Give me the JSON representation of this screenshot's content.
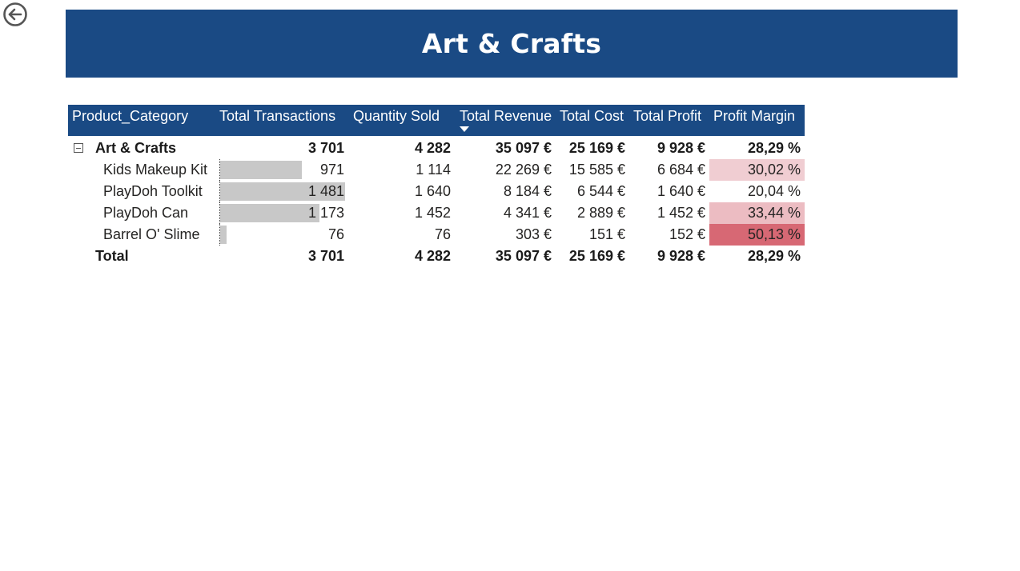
{
  "page": {
    "title": "Art & Crafts"
  },
  "icons": {
    "back": "back-arrow-circle-icon",
    "expand": "collapse-minus-icon",
    "sort": "sort-descending-caret-icon"
  },
  "colors": {
    "banner": "#1a4a84",
    "header": "#1a4a84",
    "databar": "#c8c8c8",
    "margin_scale_low": "#f0cdd2",
    "margin_scale_high": "#d76874"
  },
  "matrix": {
    "headers": {
      "category": "Product_Category",
      "transactions": "Total Transactions",
      "quantity": "Quantity Sold",
      "revenue": "Total Revenue",
      "cost": "Total Cost",
      "profit": "Total Profit",
      "margin": "Profit Margin"
    },
    "sorted_column": "revenue",
    "group": {
      "name": "Art & Crafts",
      "transactions": "3 701",
      "quantity": "4 282",
      "revenue": "35 097 €",
      "cost": "25 169 €",
      "profit": "9 928 €",
      "margin": "28,29 %"
    },
    "rows": [
      {
        "name": "Kids Makeup Kit",
        "transactions": "971",
        "transactions_value": 971,
        "quantity": "1 114",
        "revenue": "22 269 €",
        "cost": "15 585 €",
        "profit": "6 684 €",
        "margin": "30,02 %",
        "margin_color": "#f0cdd2"
      },
      {
        "name": "PlayDoh Toolkit",
        "transactions": "1 481",
        "transactions_value": 1481,
        "quantity": "1 640",
        "revenue": "8 184 €",
        "cost": "6 544 €",
        "profit": "1 640 €",
        "margin": "20,04 %",
        "margin_color": "#ffffff"
      },
      {
        "name": "PlayDoh Can",
        "transactions": "1 173",
        "transactions_value": 1173,
        "quantity": "1 452",
        "revenue": "4 341 €",
        "cost": "2 889 €",
        "profit": "1 452 €",
        "margin": "33,44 %",
        "margin_color": "#ecbcc2"
      },
      {
        "name": "Barrel O' Slime",
        "transactions": "76",
        "transactions_value": 76,
        "quantity": "76",
        "revenue": "303 €",
        "cost": "151 €",
        "profit": "152 €",
        "margin": "50,13 %",
        "margin_color": "#d76874"
      }
    ],
    "total": {
      "label": "Total",
      "transactions": "3 701",
      "quantity": "4 282",
      "revenue": "35 097 €",
      "cost": "25 169 €",
      "profit": "9 928 €",
      "margin": "28,29 %"
    }
  }
}
